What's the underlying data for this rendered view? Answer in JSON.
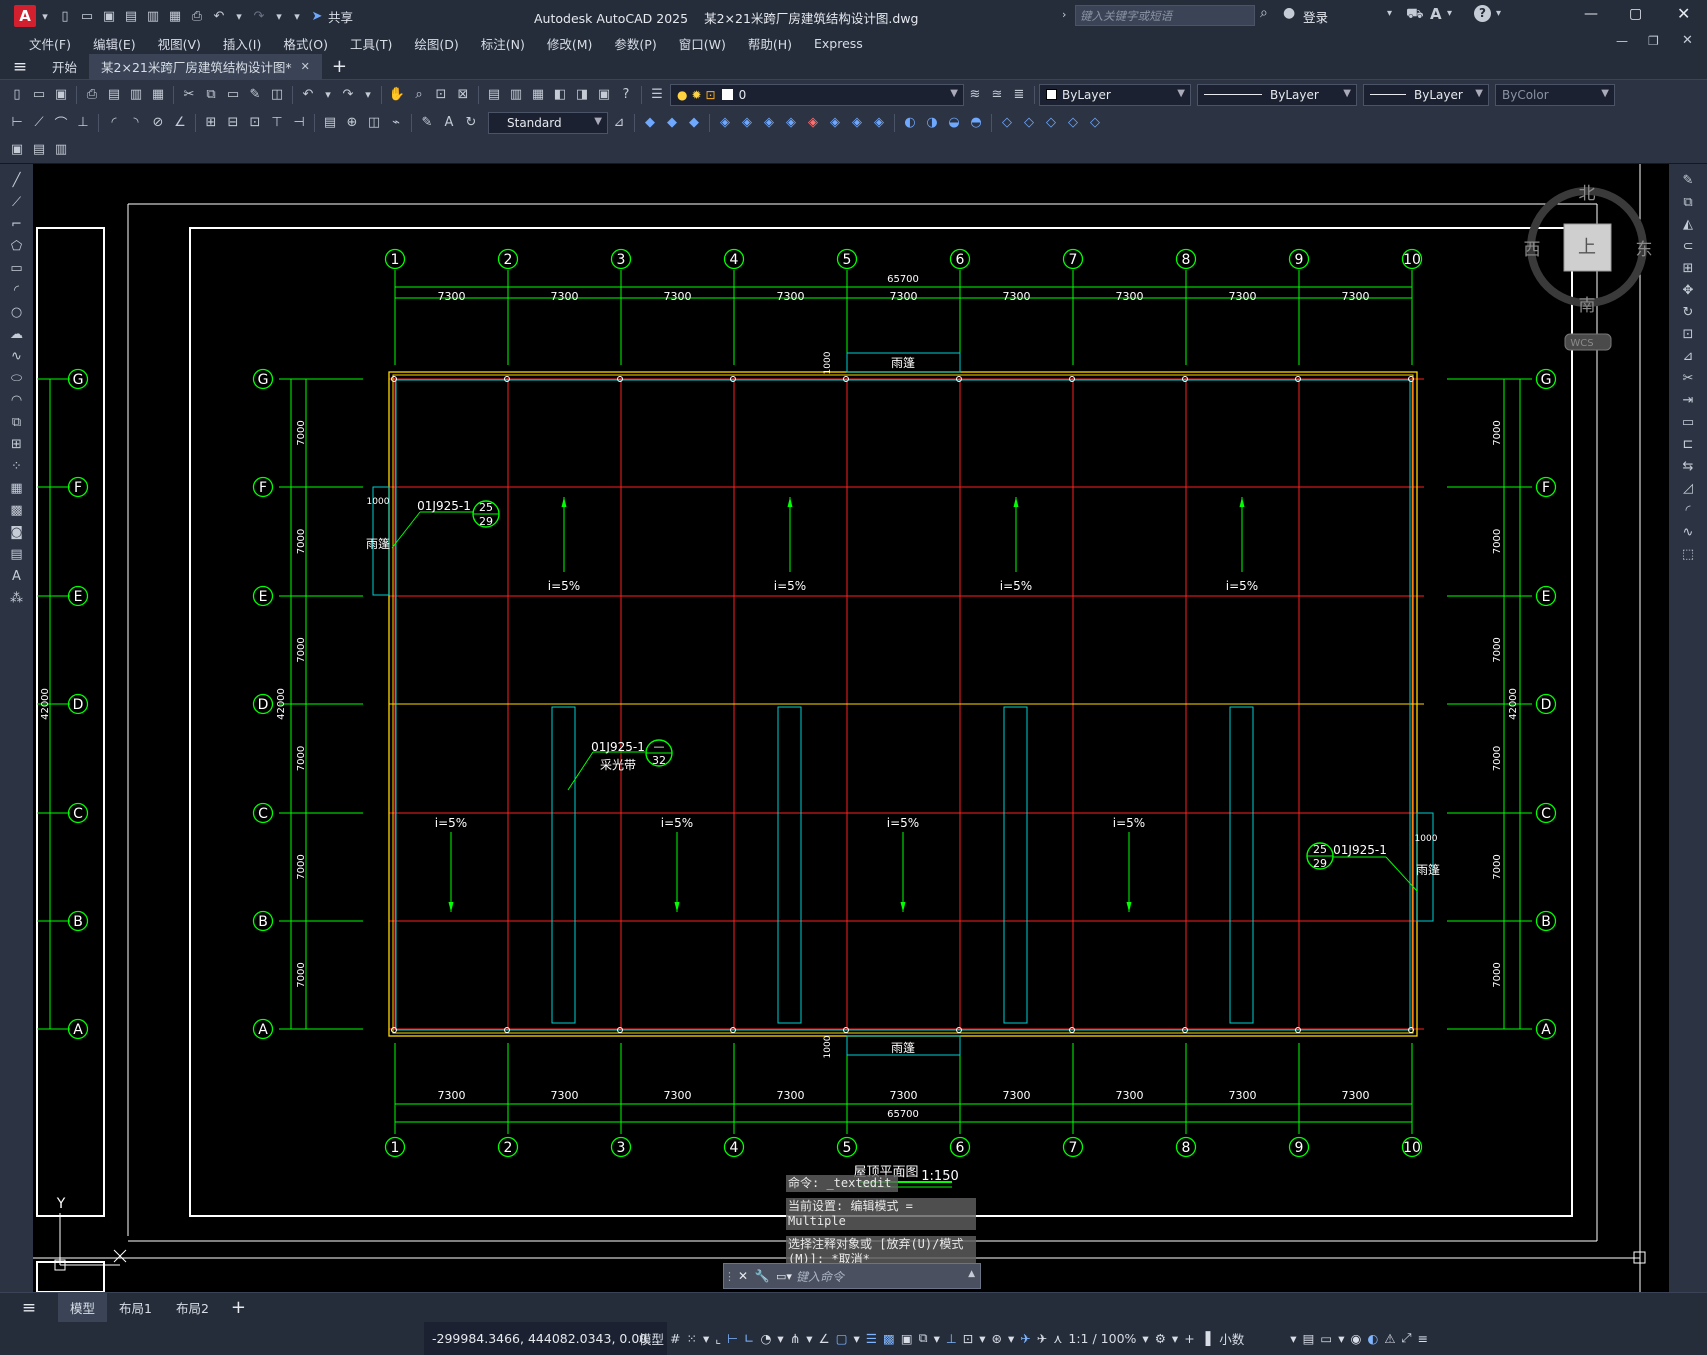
{
  "app": {
    "title": "Autodesk AutoCAD 2025",
    "filename": "某2×21米跨厂房建筑结构设计图.dwg",
    "share_label": "共享",
    "search_placeholder": "键入关键字或短语",
    "login_label": "登录"
  },
  "menu": [
    "文件(F)",
    "编辑(E)",
    "视图(V)",
    "插入(I)",
    "格式(O)",
    "工具(T)",
    "绘图(D)",
    "标注(N)",
    "修改(M)",
    "参数(P)",
    "窗口(W)",
    "帮助(H)",
    "Express"
  ],
  "tabs": {
    "start": "开始",
    "document": "某2×21米跨厂房建筑结构设计图*"
  },
  "toolbar": {
    "layer_value": "0",
    "color_value": "ByLayer",
    "linetype_value": "ByLayer",
    "lineweight_value": "ByLayer",
    "plotstyle_value": "ByColor",
    "textstyle_value": "Standard"
  },
  "drawing": {
    "column_labels": [
      "1",
      "2",
      "3",
      "4",
      "5",
      "6",
      "7",
      "8",
      "9",
      "10"
    ],
    "row_labels": [
      "G",
      "F",
      "E",
      "D",
      "C",
      "B",
      "A"
    ],
    "bay_dim": "7300",
    "span_dim": "7000",
    "total_length": "65700",
    "total_width": "42000",
    "canopy_label": "雨篷",
    "canopy_depth": "1000",
    "detail_ref": "01J925-1",
    "detail_num_a": "25",
    "detail_num_b": "29",
    "skylight_label": "采光带",
    "skylight_num_top": "—",
    "skylight_num_bottom": "32",
    "slope_label": "i=5%",
    "plan_title": "屋顶平面图",
    "plan_scale": "1:150",
    "compass": {
      "north": "北",
      "south": "南",
      "east": "东",
      "west": "西",
      "top": "上",
      "wcs": "WCS"
    },
    "ucs_y": "Y"
  },
  "command": {
    "history": [
      "命令: _textedit",
      "当前设置: 编辑模式 = Multiple",
      "选择注释对象或 [放弃(U)/模式(M)]: *取消*"
    ],
    "placeholder": "键入命令"
  },
  "layouts": [
    "模型",
    "布局1",
    "布局2"
  ],
  "status": {
    "coordinates": "-299984.3466, 444082.0343, 0.00...",
    "model_label": "模型",
    "scale": "1:1 / 100%",
    "units": "小数"
  }
}
